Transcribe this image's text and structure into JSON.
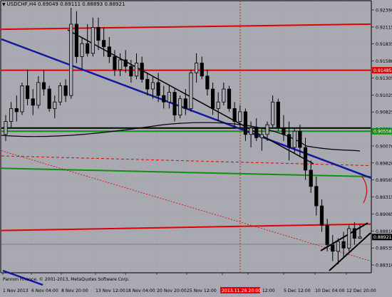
{
  "chart_title": {
    "symbol": "USDCHF,H4",
    "ohlc": "0.89049 0.89111 0.88893 0.88921"
  },
  "copyright": "Pannon Finance, © 2001-2013, MetaQuotes Software Corp.",
  "colors": {
    "background": "#a9a9b2",
    "candle": "#000000",
    "red_level": "#e00000",
    "blue_trend": "#1018a0",
    "green_level": "#109010",
    "black_line": "#000000",
    "price_tag": "#e00000",
    "period_sep": "#d02020"
  },
  "chart_data": {
    "type": "candlestick",
    "symbol": "USDCHF",
    "timeframe": "H4",
    "ylim": [
      0.8838,
      0.9255
    ],
    "y_ticks": [
      "0.92390",
      "0.92115",
      "0.91835",
      "0.91580",
      "0.91305",
      "0.91025",
      "0.90825",
      "0.90320",
      "0.90070",
      "0.89820",
      "0.89565",
      "0.89315",
      "0.89065",
      "0.88810",
      "0.88535",
      "0.88310"
    ],
    "x_ticks": [
      "1 Nov 2013",
      "6 Nov 04:00",
      "8 Nov 20:00",
      "13 Nov 12:00",
      "18 Nov 04:00",
      "20 Nov 20:00",
      "25 Nov 12:00",
      "",
      "3 Dec 12:00",
      "5 Dec 12:00",
      "10 Dec 04:00",
      "12 Dec 20:00"
    ],
    "highlight_time_label": "2013.11.28 20:00",
    "price_labels": {
      "upper_red": "0.91485",
      "green": "0.90558",
      "current": "0.88921"
    },
    "horizontal_levels": [
      {
        "kind": "red",
        "y_start": 0.9212,
        "y_end": 0.922
      },
      {
        "kind": "red",
        "y_start": 0.9149,
        "y_end": 0.9149
      },
      {
        "kind": "green",
        "y_start": 0.9055,
        "y_end": 0.9055
      },
      {
        "kind": "black",
        "y_start": 0.906,
        "y_end": 0.906
      },
      {
        "kind": "green",
        "y_start": 0.8998,
        "y_end": 0.8985
      },
      {
        "kind": "red-dashed",
        "y_start": 0.9017,
        "y_end": 0.9002
      },
      {
        "kind": "red",
        "y_start": 0.8902,
        "y_end": 0.8912
      },
      {
        "kind": "red-dashed-diag",
        "y_start": 0.9025,
        "y_end": 0.8855
      }
    ],
    "candles": [
      [
        0.905,
        0.908,
        0.904,
        0.907
      ],
      [
        0.907,
        0.91,
        0.906,
        0.909
      ],
      [
        0.909,
        0.911,
        0.907,
        0.9085
      ],
      [
        0.9085,
        0.913,
        0.908,
        0.9125
      ],
      [
        0.9125,
        0.915,
        0.9095,
        0.9105
      ],
      [
        0.9105,
        0.912,
        0.908,
        0.9095
      ],
      [
        0.9095,
        0.914,
        0.909,
        0.913
      ],
      [
        0.913,
        0.915,
        0.911,
        0.912
      ],
      [
        0.912,
        0.9125,
        0.9085,
        0.909
      ],
      [
        0.909,
        0.911,
        0.9075,
        0.91
      ],
      [
        0.91,
        0.913,
        0.9095,
        0.9125
      ],
      [
        0.9125,
        0.9135,
        0.91,
        0.911
      ],
      [
        0.911,
        0.9245,
        0.9105,
        0.922
      ],
      [
        0.922,
        0.924,
        0.916,
        0.917
      ],
      [
        0.917,
        0.92,
        0.915,
        0.919
      ],
      [
        0.919,
        0.922,
        0.917,
        0.9175
      ],
      [
        0.9175,
        0.923,
        0.917,
        0.9215
      ],
      [
        0.9215,
        0.923,
        0.918,
        0.9195
      ],
      [
        0.9195,
        0.9215,
        0.917,
        0.9185
      ],
      [
        0.9185,
        0.92,
        0.916,
        0.917
      ],
      [
        0.917,
        0.918,
        0.914,
        0.915
      ],
      [
        0.915,
        0.9175,
        0.914,
        0.9165
      ],
      [
        0.9165,
        0.918,
        0.9145,
        0.9155
      ],
      [
        0.9155,
        0.9165,
        0.913,
        0.914
      ],
      [
        0.914,
        0.9175,
        0.9135,
        0.916
      ],
      [
        0.916,
        0.917,
        0.913,
        0.9135
      ],
      [
        0.9135,
        0.9145,
        0.911,
        0.912
      ],
      [
        0.912,
        0.914,
        0.9105,
        0.913
      ],
      [
        0.913,
        0.9145,
        0.91,
        0.911
      ],
      [
        0.911,
        0.9125,
        0.909,
        0.91
      ],
      [
        0.91,
        0.9125,
        0.909,
        0.9115
      ],
      [
        0.9115,
        0.912,
        0.907,
        0.908
      ],
      [
        0.908,
        0.911,
        0.9075,
        0.9105
      ],
      [
        0.9105,
        0.912,
        0.908,
        0.909
      ],
      [
        0.909,
        0.915,
        0.9085,
        0.9145
      ],
      [
        0.9145,
        0.9175,
        0.913,
        0.916
      ],
      [
        0.916,
        0.917,
        0.9135,
        0.914
      ],
      [
        0.914,
        0.915,
        0.911,
        0.912
      ],
      [
        0.912,
        0.913,
        0.908,
        0.909
      ],
      [
        0.909,
        0.9115,
        0.907,
        0.91
      ],
      [
        0.91,
        0.913,
        0.9095,
        0.912
      ],
      [
        0.912,
        0.9125,
        0.9085,
        0.909
      ],
      [
        0.909,
        0.91,
        0.906,
        0.907
      ],
      [
        0.907,
        0.9095,
        0.906,
        0.9085
      ],
      [
        0.9085,
        0.909,
        0.904,
        0.905
      ],
      [
        0.905,
        0.907,
        0.903,
        0.906
      ],
      [
        0.906,
        0.9075,
        0.904,
        0.9045
      ],
      [
        0.9045,
        0.906,
        0.9025,
        0.905
      ],
      [
        0.905,
        0.907,
        0.904,
        0.9065
      ],
      [
        0.9065,
        0.911,
        0.906,
        0.91
      ],
      [
        0.91,
        0.9105,
        0.9055,
        0.906
      ],
      [
        0.906,
        0.908,
        0.904,
        0.905
      ],
      [
        0.905,
        0.907,
        0.901,
        0.903
      ],
      [
        0.903,
        0.906,
        0.902,
        0.9055
      ],
      [
        0.9055,
        0.9065,
        0.9015,
        0.903
      ],
      [
        0.903,
        0.9045,
        0.898,
        0.8995
      ],
      [
        0.8995,
        0.901,
        0.896,
        0.897
      ],
      [
        0.897,
        0.8985,
        0.8925,
        0.894
      ],
      [
        0.894,
        0.895,
        0.89,
        0.891
      ],
      [
        0.891,
        0.892,
        0.887,
        0.888
      ],
      [
        0.888,
        0.8895,
        0.8855,
        0.887
      ],
      [
        0.887,
        0.889,
        0.885,
        0.8885
      ],
      [
        0.8885,
        0.89,
        0.886,
        0.8875
      ],
      [
        0.8875,
        0.891,
        0.887,
        0.8905
      ],
      [
        0.8905,
        0.8915,
        0.888,
        0.889
      ],
      [
        0.889,
        0.8911,
        0.8889,
        0.8892
      ]
    ]
  }
}
